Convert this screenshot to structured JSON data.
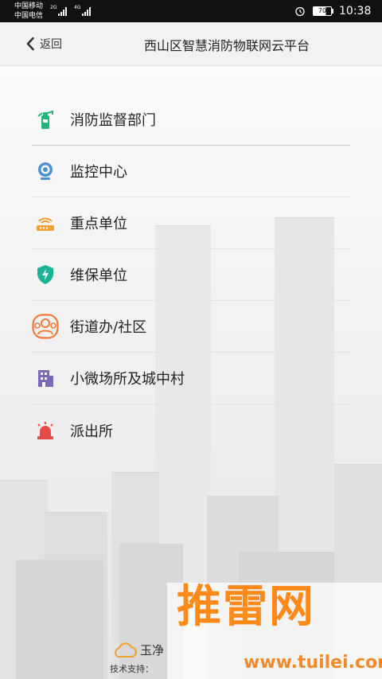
{
  "status_bar": {
    "carrier_1": "中国移动",
    "carrier_2": "中国电信",
    "network_1": "2G",
    "network_2": "4G",
    "battery": "70",
    "time": "10:38"
  },
  "header": {
    "back_label": "返回",
    "title": "西山区智慧消防物联网云平台"
  },
  "menu": {
    "items": [
      {
        "label": "消防监督部门",
        "icon": "fire-extinguisher-icon",
        "color": "#2bb07a"
      },
      {
        "label": "监控中心",
        "icon": "webcam-icon",
        "color": "#4a90d9"
      },
      {
        "label": "重点单位",
        "icon": "router-icon",
        "color": "#f0a030"
      },
      {
        "label": "维保单位",
        "icon": "shield-bolt-icon",
        "color": "#1ab394"
      },
      {
        "label": "街道办/社区",
        "icon": "community-people-icon",
        "color": "#f07a3a"
      },
      {
        "label": "小微场所及城中村",
        "icon": "building-icon",
        "color": "#7b68b8"
      },
      {
        "label": "派出所",
        "icon": "police-siren-icon",
        "color": "#e84a4a"
      }
    ]
  },
  "footer": {
    "brand": "玉净",
    "tech_support": "技术支持：",
    "brand_icon": "cloud-icon",
    "brand_color": "#f0a030"
  },
  "watermark": {
    "text": "推雷网",
    "url": "www.tuilei.com",
    "color": "#ff8a1a"
  }
}
